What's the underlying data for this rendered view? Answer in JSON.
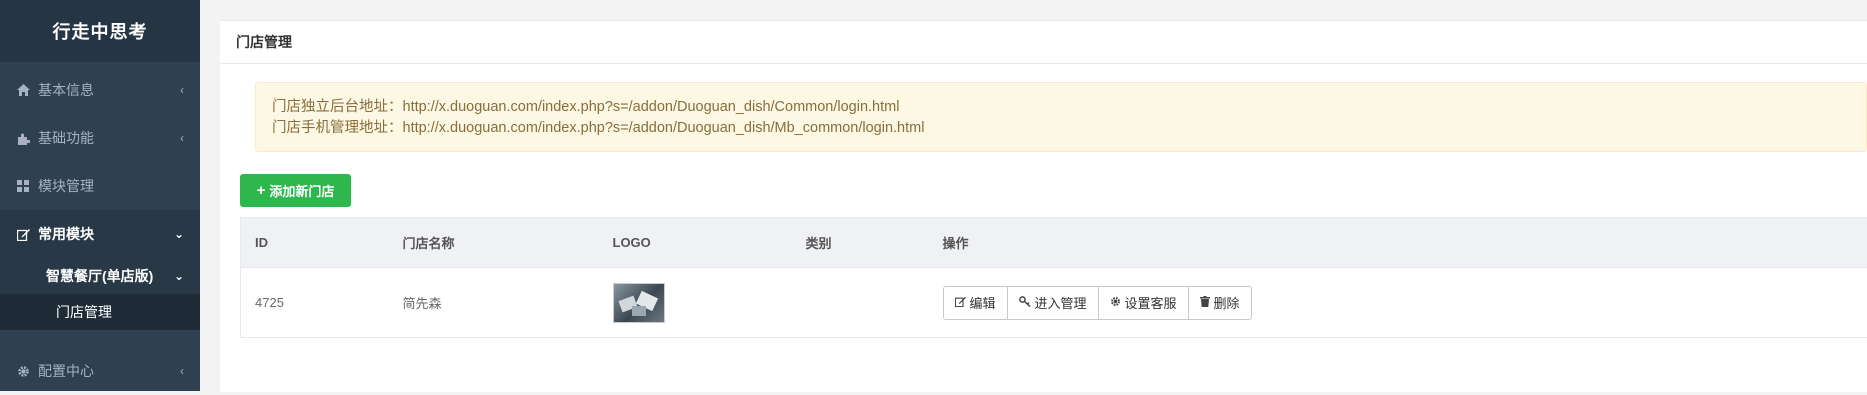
{
  "app": {
    "title": "行走中思考"
  },
  "sidebar": {
    "items": [
      {
        "label": "基本信息",
        "icon": "home-icon"
      },
      {
        "label": "基础功能",
        "icon": "puzzle-icon"
      },
      {
        "label": "模块管理",
        "icon": "grid-icon"
      },
      {
        "label": "常用模块",
        "icon": "edit-icon"
      },
      {
        "label": "配置中心",
        "icon": "gear-icon"
      }
    ],
    "sub_item": {
      "label": "智慧餐厅(单店版)"
    },
    "sub_sub_item": {
      "label": "门店管理"
    }
  },
  "panel": {
    "title": "门店管理"
  },
  "alert": {
    "line1": "门店独立后台地址：http://x.duoguan.com/index.php?s=/addon/Duoguan_dish/Common/login.html",
    "line2": "门店手机管理地址：http://x.duoguan.com/index.php?s=/addon/Duoguan_dish/Mb_common/login.html"
  },
  "toolbar": {
    "add_label": "添加新门店"
  },
  "table": {
    "headers": [
      "ID",
      "门店名称",
      "LOGO",
      "类别",
      "操作"
    ],
    "rows": [
      {
        "id": "4725",
        "name": "简先森",
        "category": ""
      }
    ],
    "actions": {
      "edit": "编辑",
      "enter": "进入管理",
      "service": "设置客服",
      "delete": "删除"
    }
  }
}
